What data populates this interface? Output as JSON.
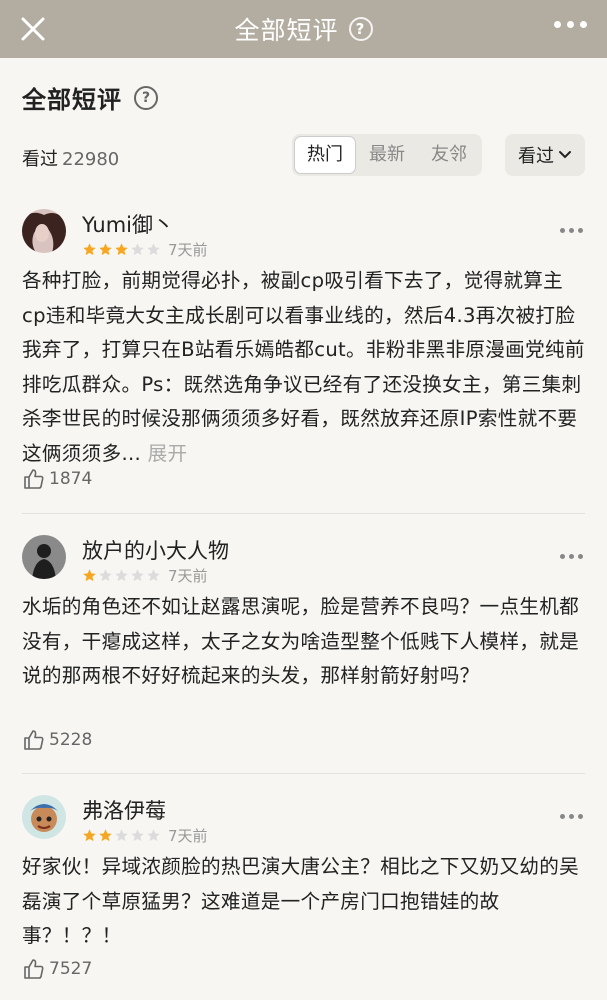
{
  "topbar": {
    "title": "全部短评",
    "help_glyph": "?",
    "close_icon": "close-icon",
    "more_icon": "more-horizontal-icon"
  },
  "section": {
    "heading": "全部短评",
    "help_glyph": "?"
  },
  "filter": {
    "seen_label": "看过",
    "seen_count": "22980",
    "tabs": [
      "热门",
      "最新",
      "友邻"
    ],
    "active_tab": "热门",
    "sort_label": "看过"
  },
  "reviews": [
    {
      "username": "Yumi御丶",
      "rating": 3,
      "time": "7天前",
      "text": "各种打脸，前期觉得必扑，被副cp吸引看下去了，觉得就算主cp违和毕竟大女主成长剧可以看事业线的，然后4.3再次被打脸我弃了，打算只在B站看乐嫣皓都cut。非粉非黑非原漫画党纯前排吃瓜群众。Ps：既然选角争议已经有了还没换女主，第三集刺杀李世民的时候没那俩须须多好看，既然放弃还原IP索性就不要这俩须须多...",
      "expand_label": "展开",
      "likes": "1874"
    },
    {
      "username": "放户的小大人物",
      "rating": 1,
      "time": "7天前",
      "text": "水垢的角色还不如让赵露思演呢，脸是营养不良吗？一点生机都没有，干瘪成这样，太子之女为啥造型整个低贱下人模样，就是说的那两根不好好梳起来的头发，那样射箭好射吗？",
      "likes": "5228"
    },
    {
      "username": "弗洛伊莓",
      "rating": 2,
      "time": "7天前",
      "text": "好家伙！异域浓颜脸的热巴演大唐公主？相比之下又奶又幼的吴磊演了个草原猛男？这难道是一个产房门口抱错娃的故事？！？！",
      "likes": "7527"
    }
  ],
  "colors": {
    "topbar": "#b3ada1",
    "background": "#f7f6f2",
    "star_filled": "#f5a623",
    "star_empty": "#dcdcdc"
  }
}
